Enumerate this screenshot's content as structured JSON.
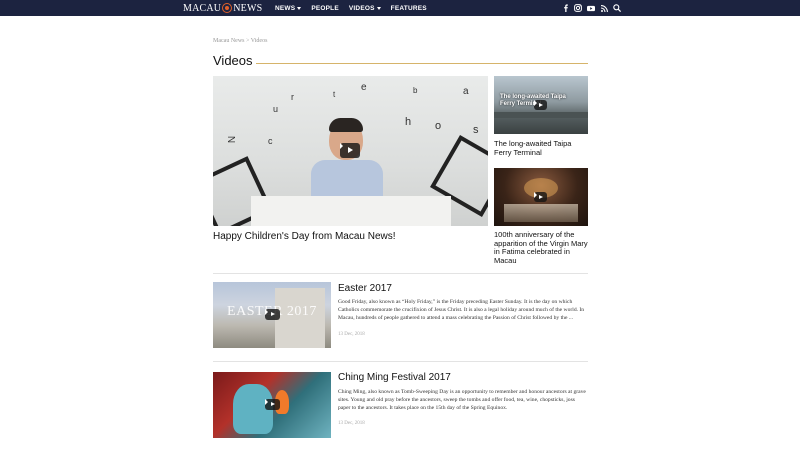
{
  "header": {
    "logo_left": "MACAU",
    "logo_right": "NEWS",
    "nav": [
      {
        "label": "NEWS",
        "has_dropdown": true
      },
      {
        "label": "PEOPLE",
        "has_dropdown": false
      },
      {
        "label": "VIDEOS",
        "has_dropdown": true
      },
      {
        "label": "FEATURES",
        "has_dropdown": false
      }
    ],
    "social_icons": [
      "facebook-icon",
      "instagram-icon",
      "youtube-icon",
      "rss-icon",
      "search-icon"
    ],
    "background": "#1c2340"
  },
  "breadcrumb": "Macau News > Videos",
  "section_title": "Videos",
  "featured": {
    "title": "Happy Children's Day from Macau News!"
  },
  "side_videos": [
    {
      "title": "The long-awaited Taipa Ferry Terminal",
      "thumb_text": "The long-awaited Taipa Ferry Terminal"
    },
    {
      "title": "100th anniversary of the apparition of the Virgin Mary in Fatima celebrated in Macau"
    }
  ],
  "list": [
    {
      "title": "Easter 2017",
      "thumb_text": "EASTER 2017",
      "excerpt": "Good Friday, also known as “Holy Friday,” is the Friday preceding Easter Sunday. It is the day on which Catholics commemorate the crucifixion of Jesus Christ. It is also a legal holiday around much of the world. In Macau, hundreds of people gathered to attend a mass celebrating the Passion of Christ followed by the ...",
      "date": "13 Dec, 2018"
    },
    {
      "title": "Ching Ming Festival 2017",
      "excerpt": "Ching Ming, also known as Tomb-Sweeping Day is an opportunity to remember and honour ancestors at grave sites. Young and old pray before the ancestors, sweep the tombs and offer food, tea, wine, chopsticks, joss paper to the ancestors. It takes place on the 15th day of the Spring Equinox.",
      "date": "13 Dec, 2018"
    }
  ]
}
